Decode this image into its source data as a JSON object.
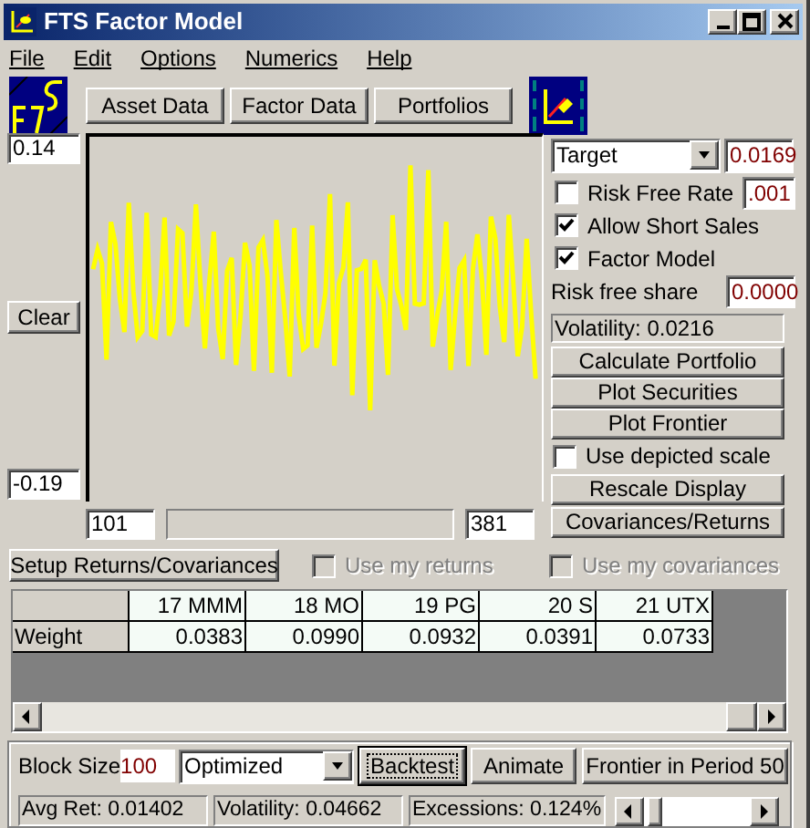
{
  "window": {
    "title": "FTS Factor Model"
  },
  "menu": [
    "File",
    "Edit",
    "Options",
    "Numerics",
    "Help"
  ],
  "toolbar_buttons": [
    "Asset Data",
    "Factor Data",
    "Portfolios"
  ],
  "chart": {
    "y_max": "0.14",
    "y_min": "-0.19",
    "clear_button": "Clear",
    "range_start": "101",
    "range_end": "381"
  },
  "settings": {
    "mode_select": "Target",
    "target_value": "0.0169",
    "options": [
      {
        "label": "Risk Free Rate",
        "checked": false,
        "value": ".001"
      },
      {
        "label": "Allow Short Sales",
        "checked": true
      },
      {
        "label": "Factor Model",
        "checked": true
      }
    ],
    "risk_free_share_label": "Risk free share",
    "risk_free_share_value": "0.0000",
    "volatility": "Volatility: 0.0216",
    "buttons": [
      "Calculate Portfolio",
      "Plot Securities",
      "Plot Frontier"
    ],
    "use_depicted_scale": {
      "label": "Use depicted scale",
      "checked": false
    },
    "buttons_2": [
      "Rescale Display",
      "Covariances/Returns"
    ]
  },
  "setup": {
    "button": "Setup Returns/Covariances",
    "checks": [
      {
        "label": "Use my returns",
        "checked": false,
        "disabled": true
      },
      {
        "label": "Use my covariances",
        "checked": false,
        "disabled": true
      }
    ]
  },
  "table": {
    "columns": [
      "17 MMM",
      "18 MO",
      "19 PG",
      "20 S",
      "21 UTX"
    ],
    "rows": [
      {
        "label": "Weight",
        "cells": [
          "0.0383",
          "0.0990",
          "0.0932",
          "0.0391",
          "0.0733"
        ]
      }
    ]
  },
  "backtest": {
    "block_size_label": "Block Size",
    "block_size": "100",
    "method_select": "Optimized",
    "buttons": [
      {
        "label": "Backtest",
        "focused": true
      },
      {
        "label": "Animate",
        "focused": false
      },
      {
        "label": "Frontier in Period 50",
        "focused": false
      }
    ],
    "status": [
      "Avg Ret: 0.01402",
      "Volatility: 0.04662",
      "Excessions: 0.124%"
    ]
  }
}
